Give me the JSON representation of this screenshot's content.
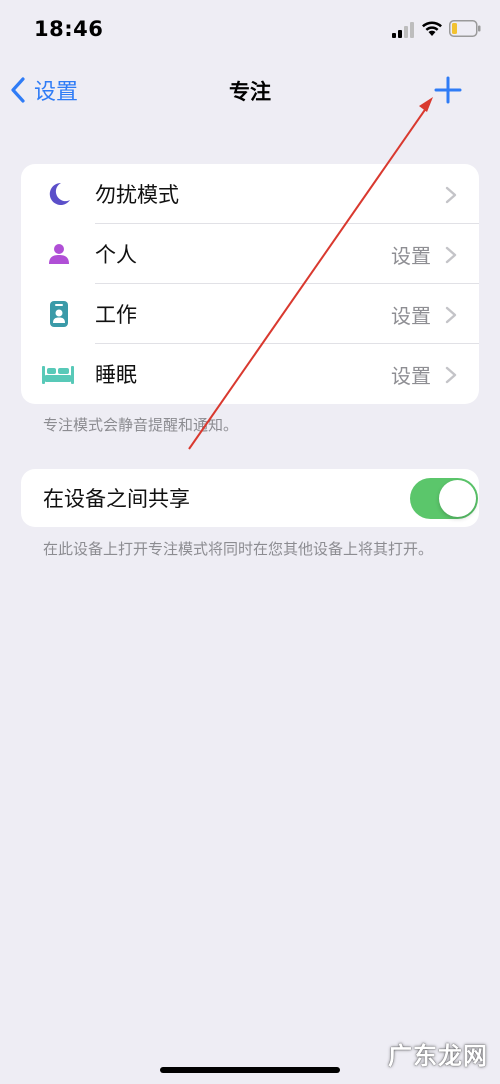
{
  "status_bar": {
    "time": "18:46"
  },
  "nav": {
    "back_label": "设置",
    "title": "专注"
  },
  "focus_modes": [
    {
      "label": "勿扰模式",
      "value": "",
      "icon": "moon-icon",
      "color": "#5b4fc9"
    },
    {
      "label": "个人",
      "value": "设置",
      "icon": "person-icon",
      "color": "#b04fd6"
    },
    {
      "label": "工作",
      "value": "设置",
      "icon": "id-badge-icon",
      "color": "#3a9aa8"
    },
    {
      "label": "睡眠",
      "value": "设置",
      "icon": "bed-icon",
      "color": "#58c9b8"
    }
  ],
  "focus_footer": "专注模式会静音提醒和通知。",
  "share": {
    "label": "在设备之间共享",
    "enabled": true,
    "footer": "在此设备上打开专注模式将同时在您其他设备上将其打开。"
  },
  "watermark": "广东龙网",
  "colors": {
    "accent": "#2f7cf6",
    "toggle_on": "#5bc66b",
    "annotation_arrow": "#d9392f",
    "background": "#eeedf4"
  }
}
